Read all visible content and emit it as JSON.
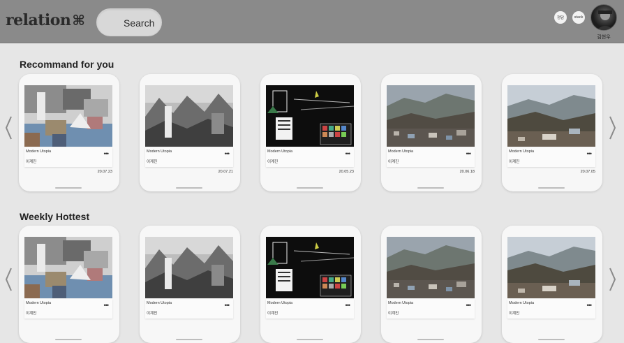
{
  "header": {
    "logo_text": "relation",
    "logo_mark": "⌘",
    "search_label": "Search",
    "pill1": "정담",
    "pill2": "stack",
    "username": "김현우"
  },
  "sections": [
    {
      "title": "Recommand for you",
      "cards": [
        {
          "title": "Modern Utopia",
          "author": "이계진",
          "date": "20.07.23",
          "art": "collage"
        },
        {
          "title": "Modern Utopia",
          "author": "이계진",
          "date": "20.07.21",
          "art": "sketch"
        },
        {
          "title": "Modern Utopia",
          "author": "이계진",
          "date": "20.05.23",
          "art": "dark"
        },
        {
          "title": "Modern Utopia",
          "author": "이계진",
          "date": "20.06.18",
          "art": "landscape"
        },
        {
          "title": "Modern Utopia",
          "author": "이계진",
          "date": "20.07.05",
          "art": "landscape2"
        }
      ]
    },
    {
      "title": "Weekly Hottest",
      "cards": [
        {
          "title": "Modern Utopia",
          "author": "이계진",
          "date": "",
          "art": "collage"
        },
        {
          "title": "Modern Utopia",
          "author": "이계진",
          "date": "",
          "art": "sketch"
        },
        {
          "title": "Modern Utopia",
          "author": "이계진",
          "date": "",
          "art": "dark"
        },
        {
          "title": "Modern Utopia",
          "author": "이계진",
          "date": "",
          "art": "landscape"
        },
        {
          "title": "Modern Utopia",
          "author": "이계진",
          "date": "",
          "art": "landscape2"
        }
      ]
    }
  ],
  "icons": {
    "prev": "chevron-left-icon",
    "next": "chevron-right-icon",
    "more": "more-icon"
  }
}
